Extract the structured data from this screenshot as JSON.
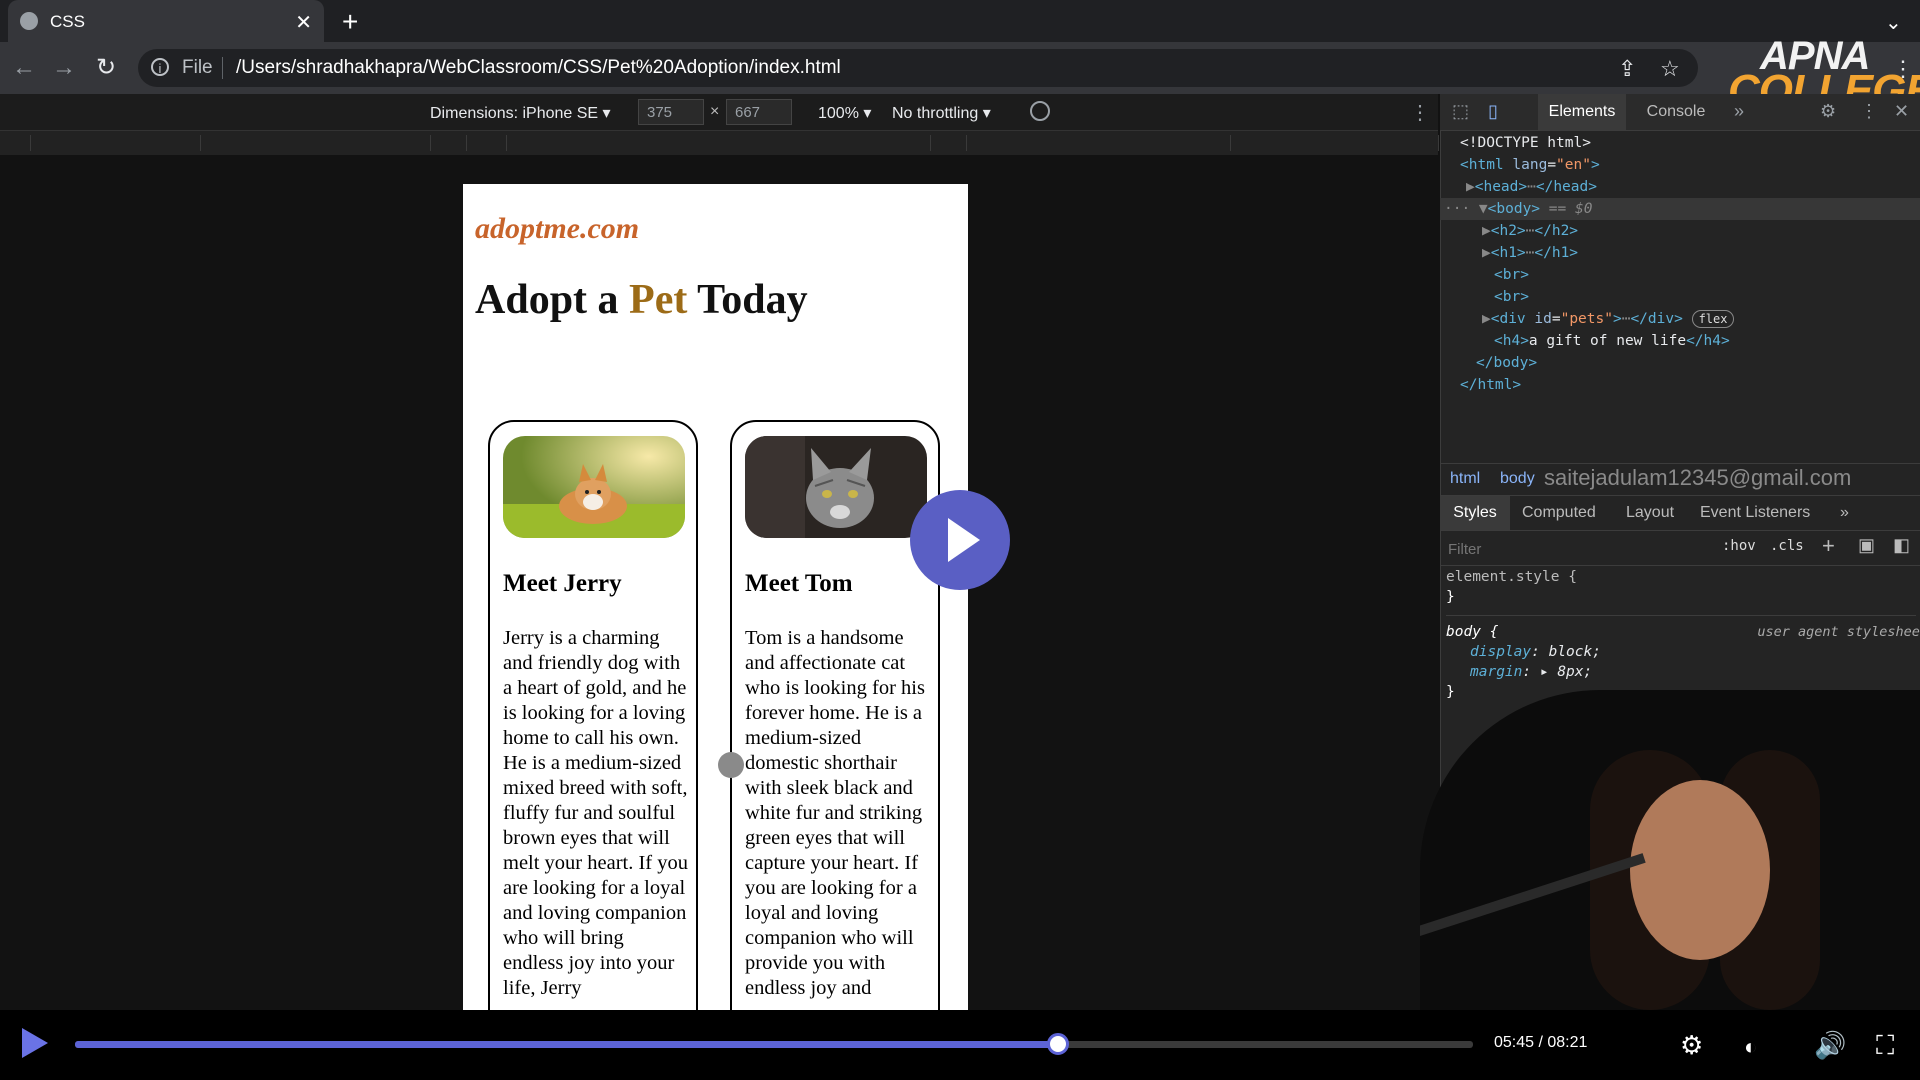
{
  "browser": {
    "tab_title": "CSS",
    "new_tab_symbol": "+",
    "close_symbol": "✕",
    "file_label": "File",
    "url": "/Users/shradhakhapra/WebClassroom/CSS/Pet%20Adoption/index.html"
  },
  "watermark": {
    "line1": "APNA",
    "line2": "COLLEGE"
  },
  "device_toolbar": {
    "dimensions_label": "Dimensions: iPhone SE ▾",
    "width": "375",
    "height": "667",
    "times": "×",
    "zoom": "100% ▾",
    "throttling": "No throttling ▾"
  },
  "page": {
    "site_name": "adoptme.com",
    "heading_before": "Adopt a ",
    "heading_accent": "Pet",
    "heading_after": " Today",
    "cards": [
      {
        "title": "Meet Jerry",
        "text": "Jerry is a charming and friendly dog with a heart of gold, and he is looking for a loving home to call his own. He is a medium-sized mixed breed with soft, fluffy fur and soulful brown eyes that will melt your heart. If you are looking for a loyal and loving companion who will bring endless joy into your life, Jerry"
      },
      {
        "title": "Meet Tom",
        "text": "Tom is a handsome and affectionate cat who is looking for his forever home. He is a medium-sized domestic shorthair with sleek black and white fur and striking green eyes that will capture your heart. If you are looking for a loyal and loving companion who will provide you with endless joy and"
      }
    ]
  },
  "devtools": {
    "tab_elements": "Elements",
    "tab_console": "Console",
    "more_tabs": "»",
    "dom": {
      "doctype": "<!DOCTYPE html>",
      "html_open": "<html",
      "lang_attr": "lang",
      "lang_val": "\"en\"",
      "head": "<head>",
      "head_close": "</head>",
      "body_open": "<body>",
      "eq_sel": "== $0",
      "h2": "<h2>",
      "h2_close": "</h2>",
      "h1": "<h1>",
      "h1_close": "</h1>",
      "br": "<br>",
      "div_open": "<div",
      "id_attr": "id",
      "id_val": "\"pets\"",
      "div_close": "</div>",
      "flex_badge": "flex",
      "h4_open": "<h4>",
      "h4_text": "a gift of new life",
      "h4_close": "</h4>",
      "body_close": "</body>",
      "html_close": "</html>",
      "ellipsis": "⋯"
    },
    "breadcrumbs": [
      "html",
      "body"
    ],
    "email_overlay": "saitejadulam12345@gmail.com",
    "style_tabs": [
      "Styles",
      "Computed",
      "Layout",
      "Event Listeners",
      "»"
    ],
    "filter_placeholder": "Filter",
    "hov": ":hov",
    "cls": ".cls",
    "css": {
      "element_style": "element.style {",
      "close_brace": "}",
      "body_selector": "body {",
      "ua_label": "user agent stylesheet",
      "display_prop": "display",
      "display_val": "block;",
      "margin_prop": "margin",
      "margin_val": "▸ 8px;"
    }
  },
  "player": {
    "progress_fraction": 0.703,
    "time": "05:45 / 08:21"
  }
}
